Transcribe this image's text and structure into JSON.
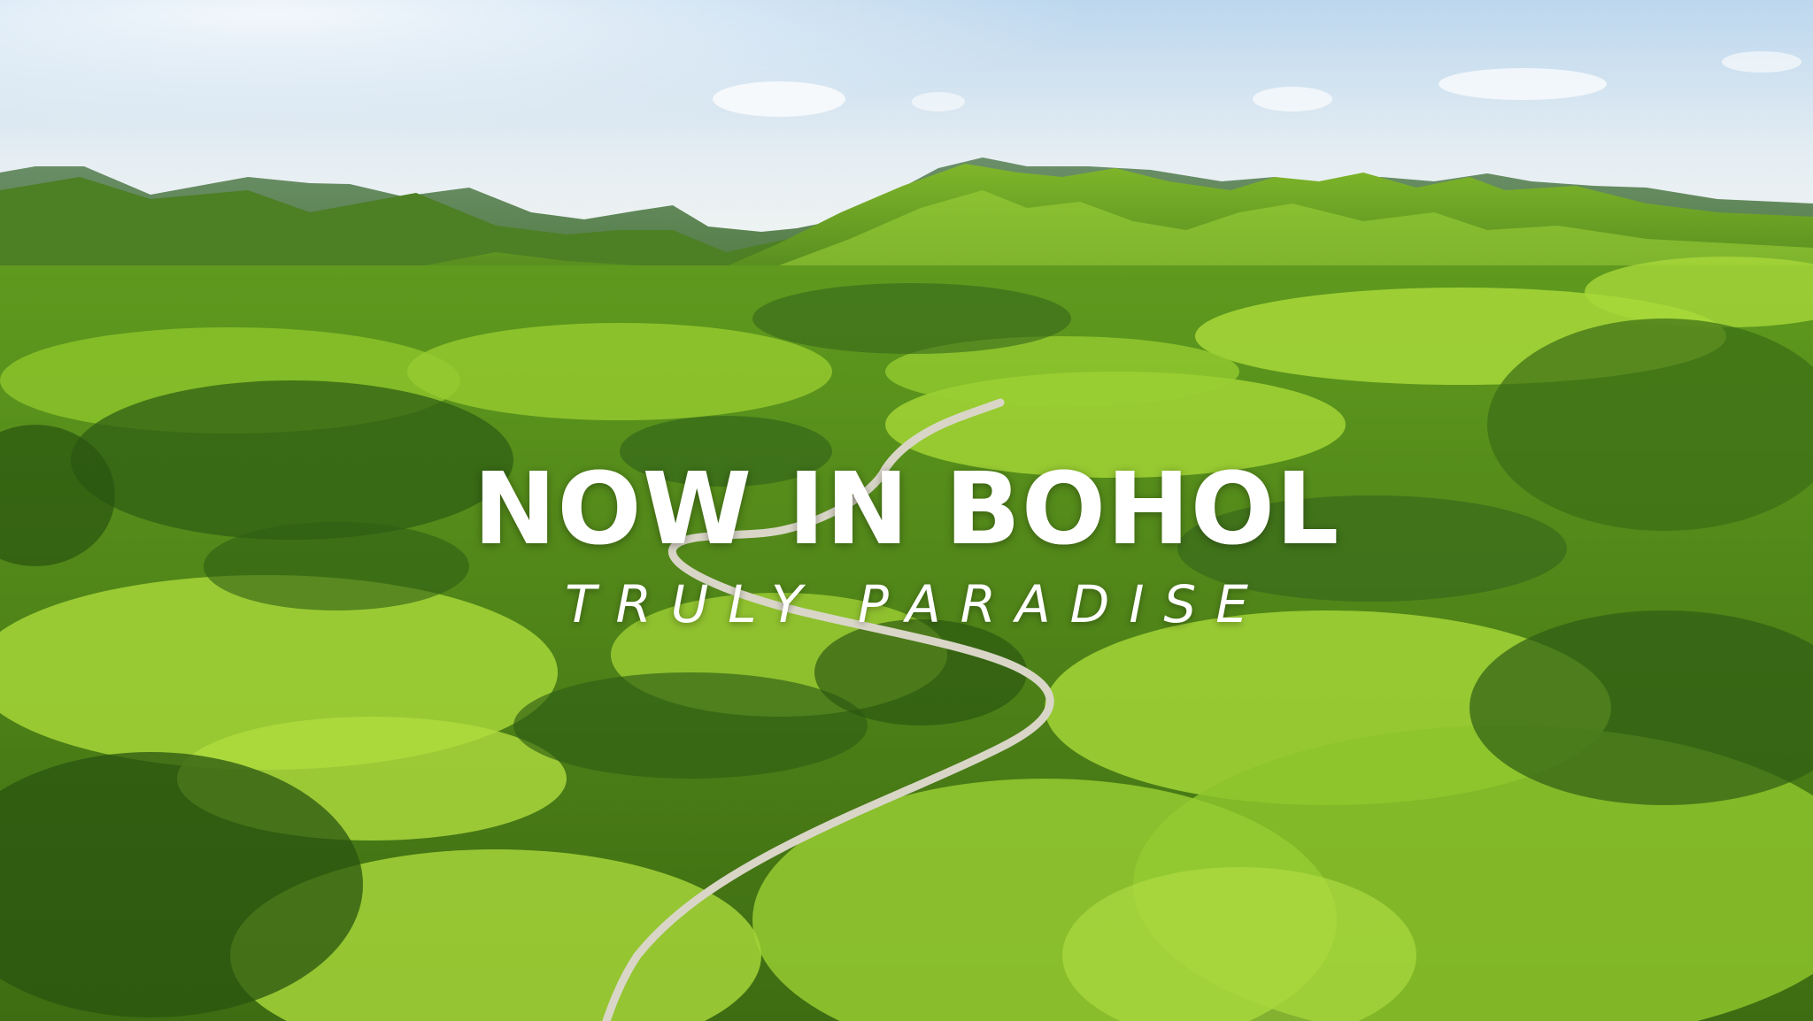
{
  "hero": {
    "headline": "NOW IN BOHOL",
    "subline": "TRULY PARADISE"
  },
  "scene": {
    "description_colors": {
      "sky_top": "#c9dff0",
      "sky_bottom": "#eef3f5",
      "far_mountains": "#5f8a5a",
      "mid_hills": "#4f8a1e",
      "bright_grass": "#9ccf2a",
      "forest": "#2f5d14",
      "road": "#d9d6c8"
    }
  }
}
